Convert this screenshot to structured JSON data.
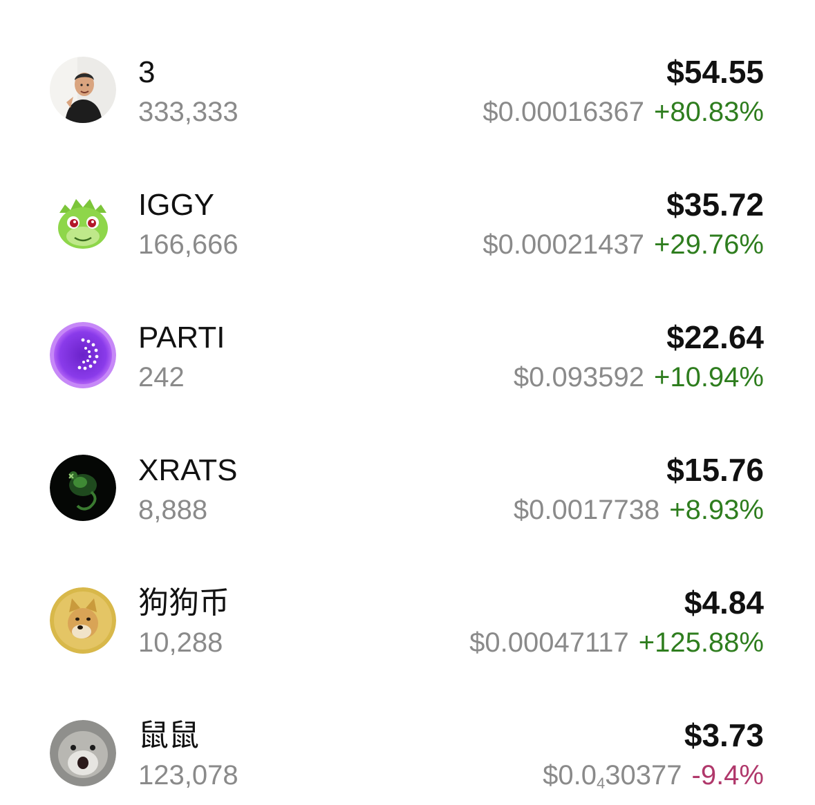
{
  "colors": {
    "up": "#2e7d1e",
    "down": "#b0386b",
    "secondary_text": "#8a8a8a",
    "primary_text": "#111111"
  },
  "assets": [
    {
      "name": "3",
      "quantity": "333,333",
      "value": "$54.55",
      "price": "$0.00016367",
      "change": "+80.83%",
      "direction": "up",
      "icon": "man-portrait-icon"
    },
    {
      "name": "IGGY",
      "quantity": "166,666",
      "value": "$35.72",
      "price": "$0.00021437",
      "change": "+29.76%",
      "direction": "up",
      "icon": "green-dragon-icon"
    },
    {
      "name": "PARTI",
      "quantity": "242",
      "value": "$22.64",
      "price": "$0.093592",
      "change": "+10.94%",
      "direction": "up",
      "icon": "purple-spiral-icon"
    },
    {
      "name": "XRATS",
      "quantity": "8,888",
      "value": "$15.76",
      "price": "$0.0017738",
      "change": "+8.93%",
      "direction": "up",
      "icon": "green-rat-icon"
    },
    {
      "name": "狗狗币",
      "quantity": "10,288",
      "value": "$4.84",
      "price": "$0.00047117",
      "change": "+125.88%",
      "direction": "up",
      "icon": "doge-icon"
    },
    {
      "name": "鼠鼠",
      "quantity": "123,078",
      "value": "$3.73",
      "price_prefix": "$0.0",
      "price_zeros": "4",
      "price_digits": "30377",
      "change": "-9.4%",
      "direction": "down",
      "icon": "hamster-icon"
    }
  ]
}
